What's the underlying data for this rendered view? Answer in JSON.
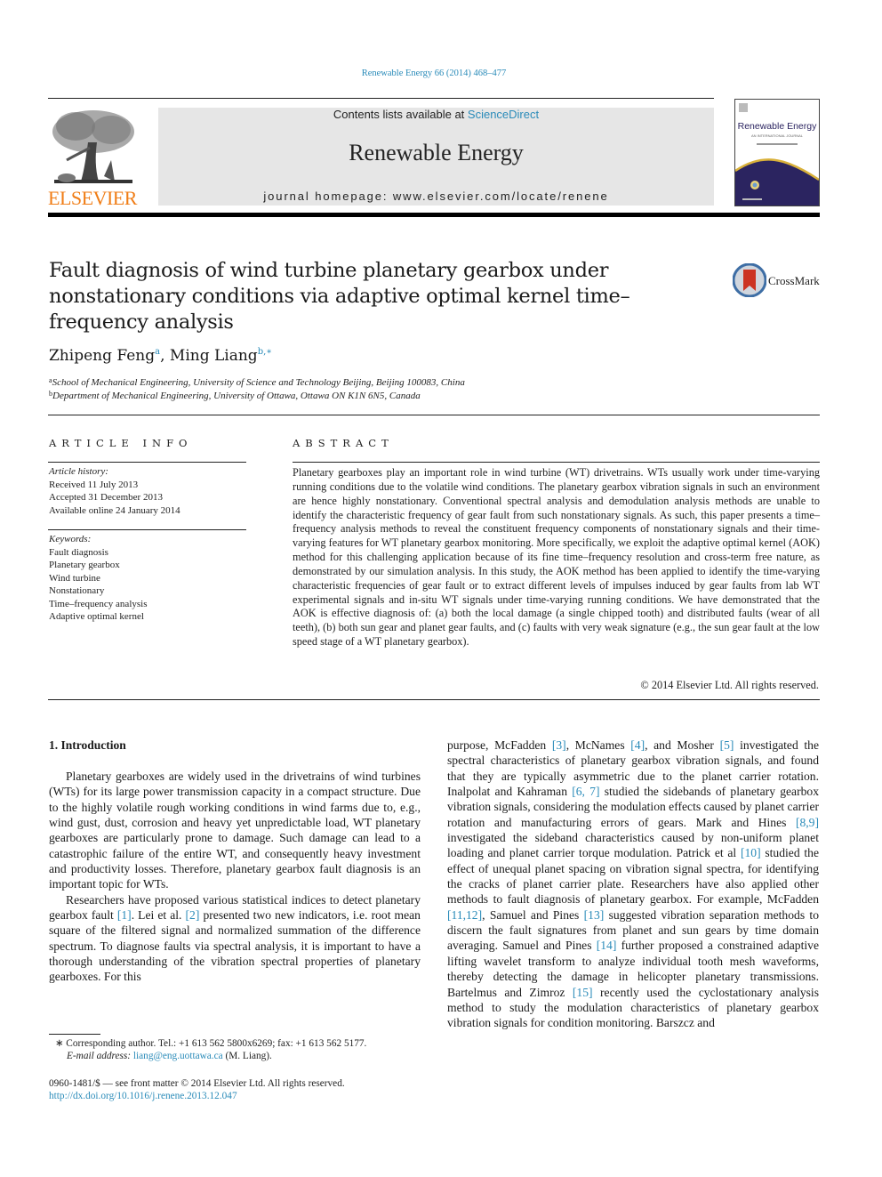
{
  "header": {
    "citation": "Renewable Energy 66 (2014) 468–477",
    "contents_prefix": "Contents lists available at ",
    "contents_link": "ScienceDirect",
    "journal_title": "Renewable Energy",
    "homepage_label": "journal homepage: ",
    "homepage_url": "www.elsevier.com/locate/renene",
    "publisher_wordmark": "ELSEVIER",
    "cover": {
      "title": "Renewable Energy",
      "subtitle": "AN INTERNATIONAL JOURNAL"
    },
    "colors": {
      "link": "#2a8bb9",
      "elsevier_orange": "#f07d16",
      "cover_navy": "#2b2460",
      "cover_gold": "#d9b13a"
    }
  },
  "article": {
    "title": "Fault diagnosis of wind turbine planetary gearbox under nonstationary conditions via adaptive optimal kernel time–frequency analysis",
    "crossmark_label": "CrossMark",
    "authors": [
      {
        "name": "Zhipeng Feng",
        "marks": "a"
      },
      {
        "name": "Ming Liang",
        "marks": "b,∗"
      }
    ],
    "affiliations": [
      {
        "mark": "a",
        "text": "School of Mechanical Engineering, University of Science and Technology Beijing, Beijing 100083, China"
      },
      {
        "mark": "b",
        "text": "Department of Mechanical Engineering, University of Ottawa, Ottawa ON K1N 6N5, Canada"
      }
    ]
  },
  "article_info": {
    "heading": "ARTICLE INFO",
    "history_label": "Article history:",
    "history": [
      "Received 11 July 2013",
      "Accepted 31 December 2013",
      "Available online 24 January 2014"
    ],
    "keywords_label": "Keywords:",
    "keywords": [
      "Fault diagnosis",
      "Planetary gearbox",
      "Wind turbine",
      "Nonstationary",
      "Time–frequency analysis",
      "Adaptive optimal kernel"
    ]
  },
  "abstract": {
    "heading": "ABSTRACT",
    "text": "Planetary gearboxes play an important role in wind turbine (WT) drivetrains. WTs usually work under time-varying running conditions due to the volatile wind conditions. The planetary gearbox vibration signals in such an environment are hence highly nonstationary. Conventional spectral analysis and demodulation analysis methods are unable to identify the characteristic frequency of gear fault from such nonstationary signals. As such, this paper presents a time–frequency analysis methods to reveal the constituent frequency components of nonstationary signals and their time-varying features for WT planetary gearbox monitoring. More specifically, we exploit the adaptive optimal kernel (AOK) method for this challenging application because of its fine time–frequency resolution and cross-term free nature, as demonstrated by our simulation analysis. In this study, the AOK method has been applied to identify the time-varying characteristic frequencies of gear fault or to extract different levels of impulses induced by gear faults from lab WT experimental signals and in-situ WT signals under time-varying running conditions. We have demonstrated that the AOK is effective diagnosis of: (a) both the local damage (a single chipped tooth) and distributed faults (wear of all teeth), (b) both sun gear and planet gear faults, and (c) faults with very weak signature (e.g., the sun gear fault at the low speed stage of a WT planetary gearbox).",
    "copyright": "© 2014 Elsevier Ltd. All rights reserved."
  },
  "introduction": {
    "heading": "1.  Introduction",
    "left_paragraphs": [
      [
        {
          "t": "Planetary gearboxes are widely used in the drivetrains of wind turbines (WTs) for its large power transmission capacity in a compact structure. Due to the highly volatile rough working conditions in wind farms due to, e.g., wind gust, dust, corrosion and heavy yet unpredictable load, WT planetary gearboxes are particularly prone to damage. Such damage can lead to a catastrophic failure of the entire WT, and consequently heavy investment and productivity losses. Therefore, planetary gearbox fault diagnosis is an important topic for WTs."
        }
      ],
      [
        {
          "t": "Researchers have proposed various statistical indices to detect planetary gearbox fault "
        },
        {
          "ref": "[1]"
        },
        {
          "t": ". Lei et al. "
        },
        {
          "ref": "[2]"
        },
        {
          "t": " presented two new indicators, i.e. root mean square of the filtered signal and normalized summation of the difference spectrum. To diagnose faults via spectral analysis, it is important to have a thorough understanding of the vibration spectral properties of planetary gearboxes. For this"
        }
      ]
    ],
    "right_paragraph": [
      {
        "t": "purpose, McFadden "
      },
      {
        "ref": "[3]"
      },
      {
        "t": ", McNames "
      },
      {
        "ref": "[4]"
      },
      {
        "t": ", and Mosher "
      },
      {
        "ref": "[5]"
      },
      {
        "t": " investigated the spectral characteristics of planetary gearbox vibration signals, and found that they are typically asymmetric due to the planet carrier rotation. Inalpolat and Kahraman "
      },
      {
        "ref": "[6, 7]"
      },
      {
        "t": " studied the sidebands of planetary gearbox vibration signals, considering the modulation effects caused by planet carrier rotation and manufacturing errors of gears. Mark and Hines "
      },
      {
        "ref": "[8,9]"
      },
      {
        "t": " investigated the sideband characteristics caused by non-uniform planet loading and planet carrier torque modulation. Patrick et al "
      },
      {
        "ref": "[10]"
      },
      {
        "t": " studied the effect of unequal planet spacing on vibration signal spectra, for identifying the cracks of planet carrier plate. Researchers have also applied other methods to fault diagnosis of planetary gearbox. For example, McFadden "
      },
      {
        "ref": "[11,12]"
      },
      {
        "t": ", Samuel and Pines "
      },
      {
        "ref": "[13]"
      },
      {
        "t": " suggested vibration separation methods to discern the fault signatures from planet and sun gears by time domain averaging. Samuel and Pines "
      },
      {
        "ref": "[14]"
      },
      {
        "t": " further proposed a constrained adaptive lifting wavelet transform to analyze individual tooth mesh waveforms, thereby detecting the damage in helicopter planetary transmissions. Bartelmus and Zimroz "
      },
      {
        "ref": "[15]"
      },
      {
        "t": " recently used the cyclostationary analysis method to study the modulation characteristics of planetary gearbox vibration signals for condition monitoring. Barszcz and"
      }
    ]
  },
  "footnote": {
    "corresponding": "∗  Corresponding author. Tel.: +1 613 562 5800x6269; fax: +1 613 562 5177.",
    "email_label": "E-mail address: ",
    "email": "liang@eng.uottawa.ca",
    "email_suffix": " (M. Liang).",
    "front_matter": "0960-1481/$ — see front matter © 2014 Elsevier Ltd. All rights reserved.",
    "doi": "http://dx.doi.org/10.1016/j.renene.2013.12.047"
  }
}
